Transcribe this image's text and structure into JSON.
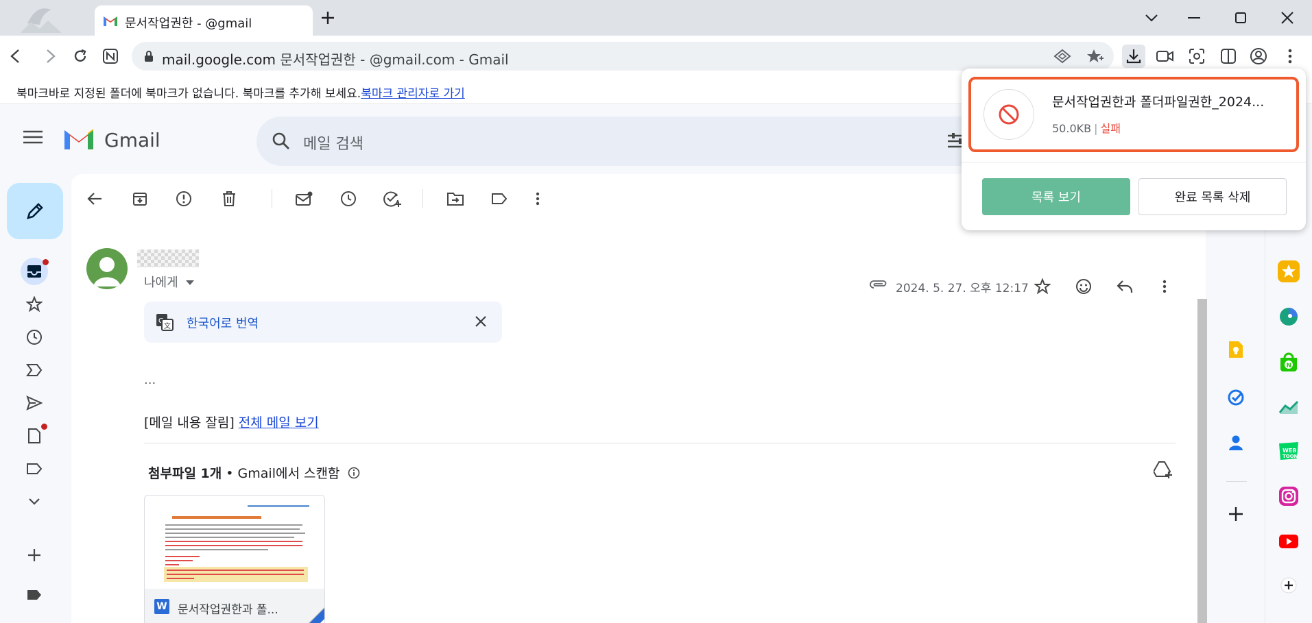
{
  "browser": {
    "tab_title": "문서작업권한 -          @gmail",
    "new_tab_label": "+",
    "address": {
      "domain": "mail.google.com",
      "title": " 문서작업권한 -            @gmail.com - Gmail"
    },
    "bookmark_bar": {
      "message": "북마크바로 지정된 폴더에 북마크가 없습니다. 북마크를 추가해 보세요.",
      "link": "북마크 관리자로 가기"
    }
  },
  "gmail": {
    "wordmark": "Gmail",
    "search_placeholder": "메일 검색",
    "message": {
      "recipient_label": "나에게",
      "datetime": "2024. 5. 27. 오후 12:17",
      "translate_label": "한국어로 번역",
      "ellipsis": "...",
      "clipped_text": "[메일 내용 잘림]",
      "view_full_link": "전체 메일 보기",
      "attachments_heading": "첨부파일 1개",
      "attachments_scanned": " • Gmail에서 스캔함",
      "attachment_name": "문서작업권한과 폴...",
      "attachment_type_letter": "W"
    }
  },
  "download_popup": {
    "filename": "문서작업권한과 폴더파일권한_2024...",
    "size": "50.0KB",
    "separator": "|",
    "status": "실패",
    "view_list_button": "목록 보기",
    "clear_completed_button": "완료 목록 삭제"
  },
  "colors": {
    "accent_green": "#66bb98",
    "highlight_border": "#ef5a2f",
    "failure_red": "#e8483b",
    "link_blue": "#1a47d6"
  },
  "icons": [
    "back-icon",
    "forward-icon",
    "reload-icon",
    "lock-icon",
    "download-icon",
    "block-icon",
    "star-icon",
    "reply-icon",
    "more-icon",
    "translate-icon",
    "close-icon",
    "attachment-icon"
  ]
}
